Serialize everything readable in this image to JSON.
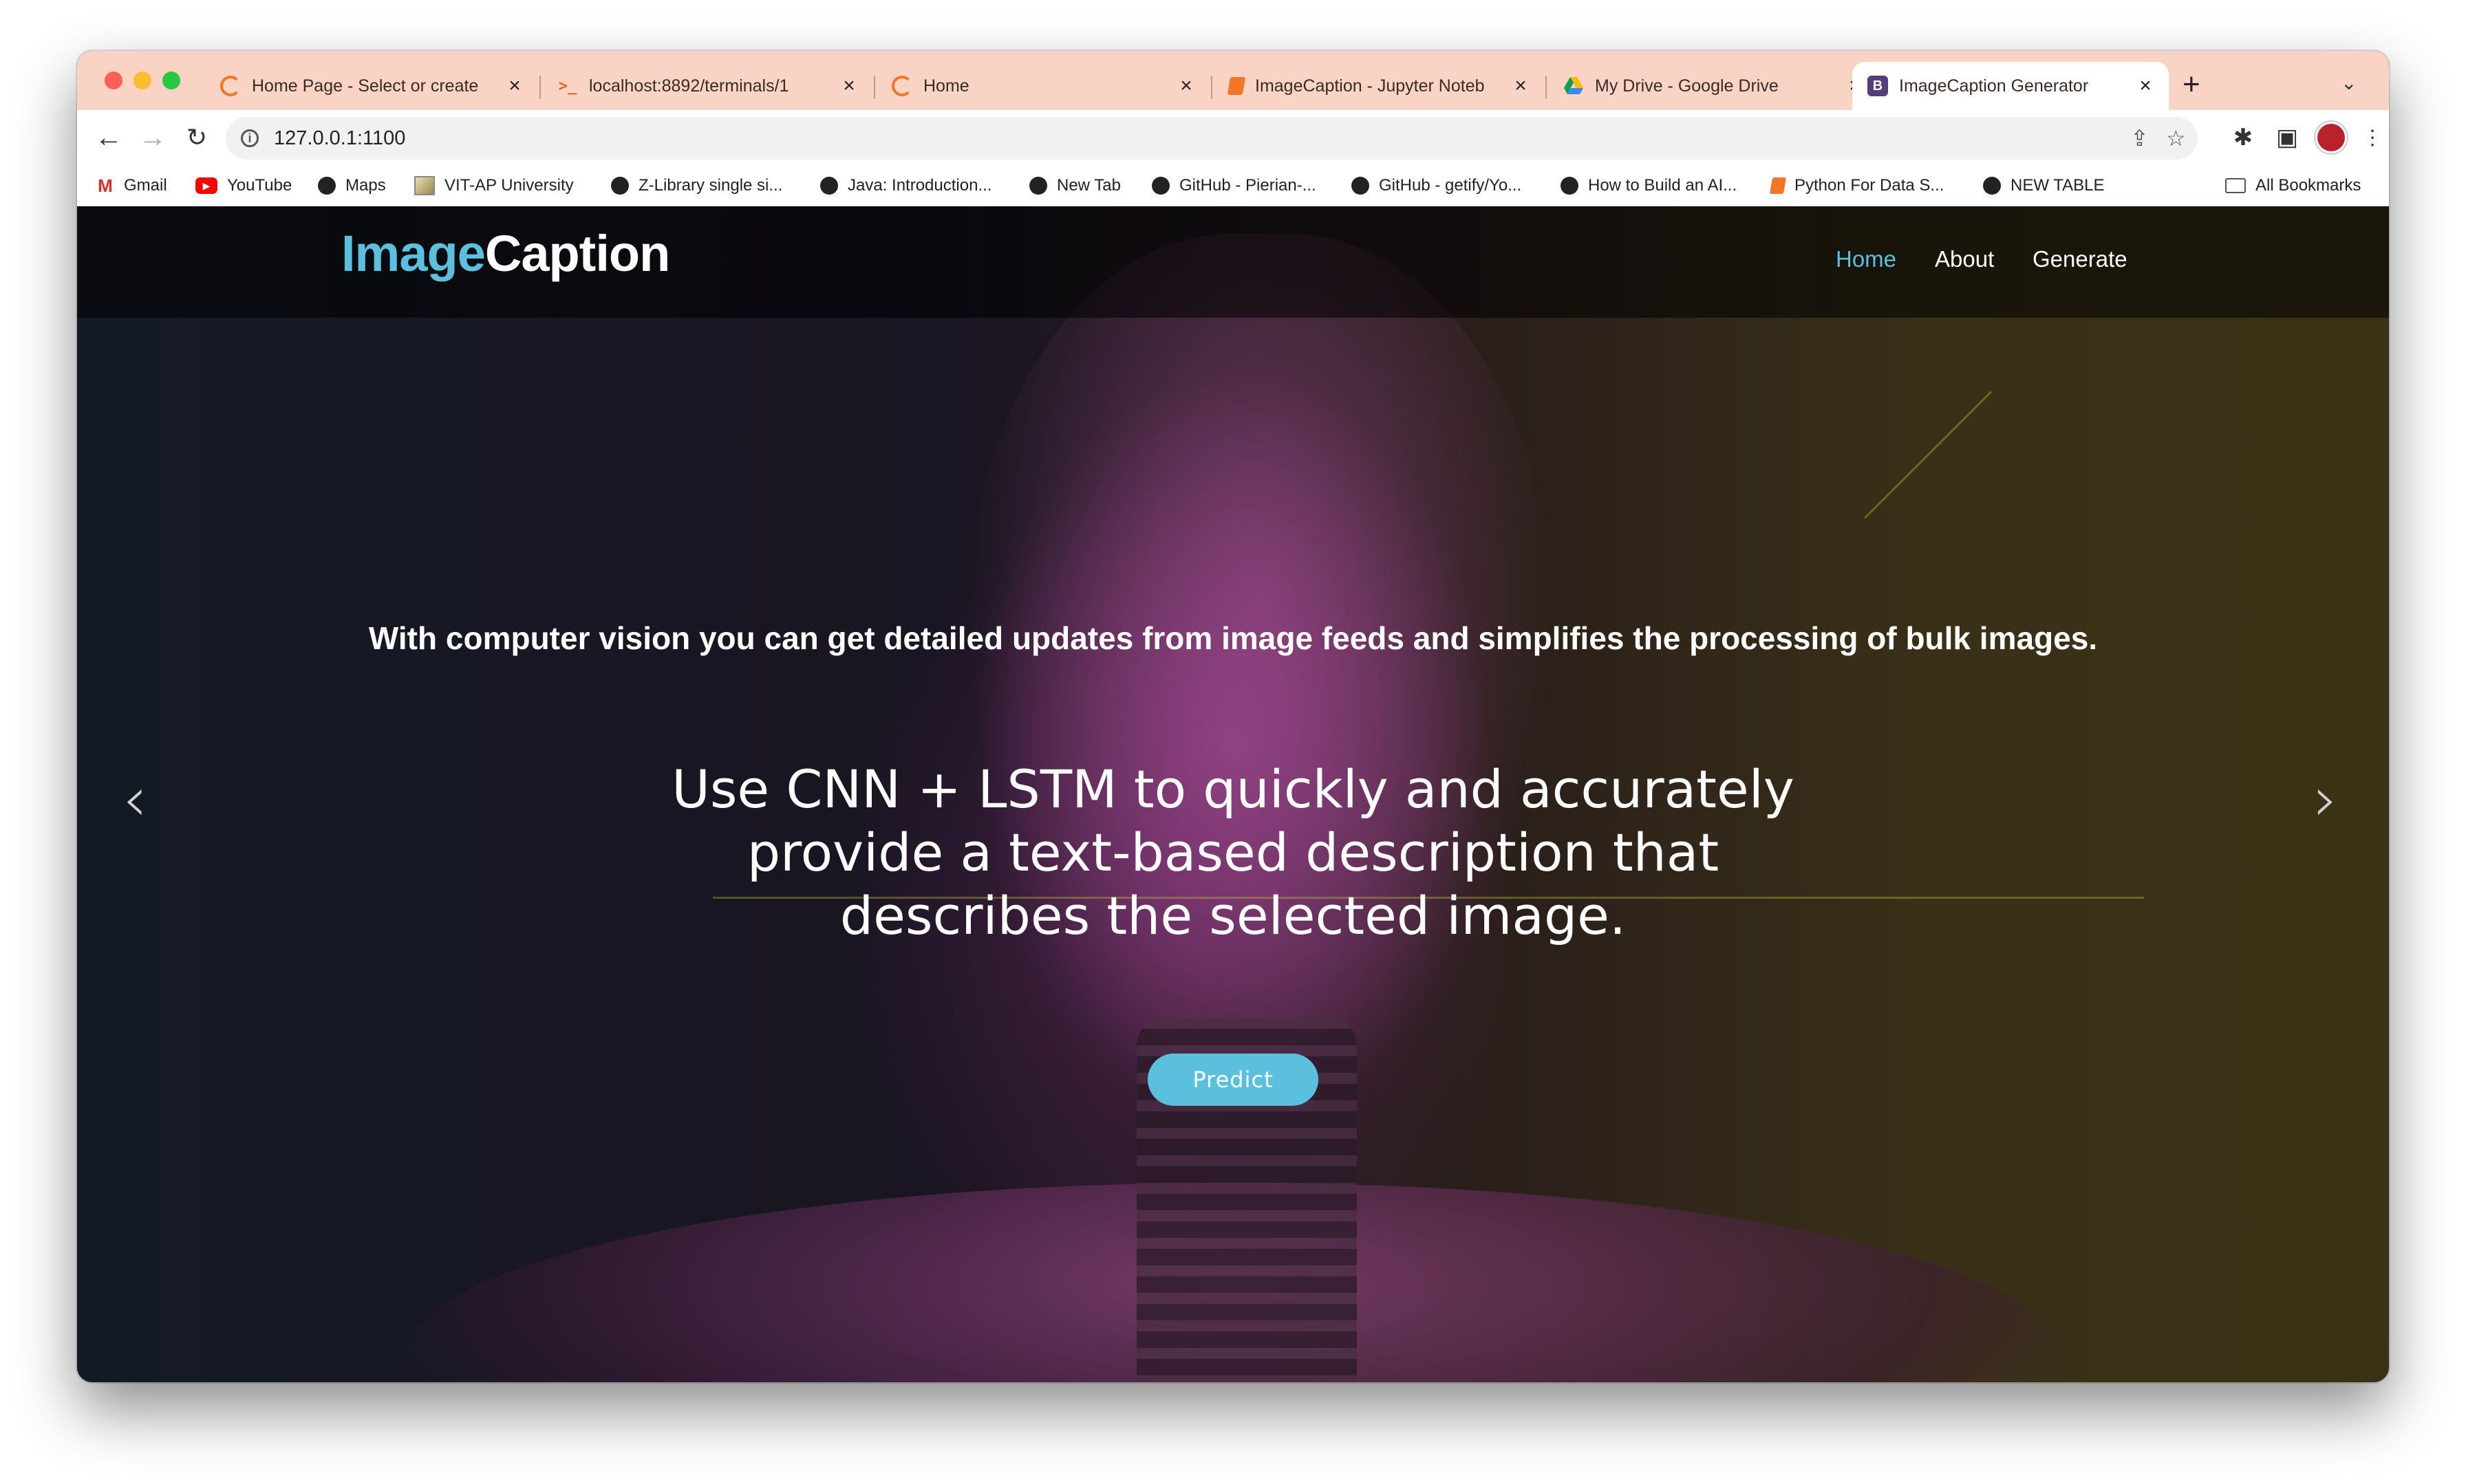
{
  "browser": {
    "tabs": [
      {
        "title": "Home Page - Select or create",
        "icon": "jupyter-icon"
      },
      {
        "title": "localhost:8892/terminals/1",
        "icon": "terminal-icon"
      },
      {
        "title": "Home",
        "icon": "jupyter-icon"
      },
      {
        "title": "ImageCaption - Jupyter Noteb",
        "icon": "notebook-icon"
      },
      {
        "title": "My Drive - Google Drive",
        "icon": "google-drive-icon"
      },
      {
        "title": "ImageCaption Generator",
        "icon": "bootstrap-icon",
        "active": true
      }
    ],
    "tab_close": "×",
    "new_tab": "+",
    "url": "127.0.0.1:1100",
    "bookmarks": [
      {
        "label": "Gmail",
        "icon": "gmail-icon"
      },
      {
        "label": "YouTube",
        "icon": "youtube-icon"
      },
      {
        "label": "Maps",
        "icon": "globe-icon"
      },
      {
        "label": "VIT-AP University",
        "icon": "image-icon"
      },
      {
        "label": "Z-Library single si...",
        "icon": "globe-icon"
      },
      {
        "label": "Java: Introduction...",
        "icon": "globe-icon"
      },
      {
        "label": "New Tab",
        "icon": "globe-icon"
      },
      {
        "label": "GitHub - Pierian-...",
        "icon": "github-icon"
      },
      {
        "label": "GitHub - getify/Yo...",
        "icon": "globe-icon"
      },
      {
        "label": "How to Build an AI...",
        "icon": "globe-icon"
      },
      {
        "label": "Python For Data S...",
        "icon": "jupyter-icon"
      },
      {
        "label": "NEW TABLE",
        "icon": "globe-icon"
      }
    ],
    "all_bookmarks": "All Bookmarks"
  },
  "site": {
    "brand_part1": "Image",
    "brand_part2": "Caption",
    "nav": [
      "Home",
      "About",
      "Generate"
    ],
    "active_nav": "Home",
    "accent_color": "#5bc0de"
  },
  "hero": {
    "subtitle": "With computer vision you can get detailed updates from image feeds and simplifies the processing of bulk images.",
    "headline": "Use CNN + LSTM to quickly and accurately provide a text-based description that describes the selected image.",
    "button": "Predict",
    "prev_arrow": "‹",
    "next_arrow": "›",
    "carousel_slides": 3,
    "carousel_active_index": 1
  }
}
